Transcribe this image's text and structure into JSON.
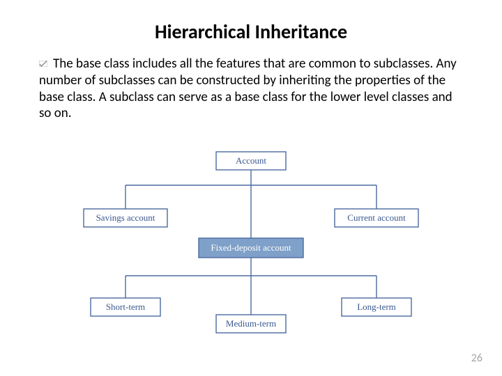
{
  "title": "Hierarchical Inheritance",
  "body": "The base class includes all the features that are common to subclasses. Any number of subclasses can be constructed by inheriting the properties of the base class. A subclass can serve as a base class for the lower level classes and so on.",
  "page_number": "26",
  "diagram": {
    "root": "Account",
    "level1": {
      "left": "Savings account",
      "center": "Fixed-deposit account",
      "right": "Current account"
    },
    "level2": {
      "left": "Short-term",
      "center": "Medium-term",
      "right": "Long-term"
    },
    "highlighted": "Fixed-deposit account"
  },
  "colors": {
    "line": "#4b6aa0",
    "text": "#3a5890",
    "highlight_fill": "#7fa0c8"
  }
}
